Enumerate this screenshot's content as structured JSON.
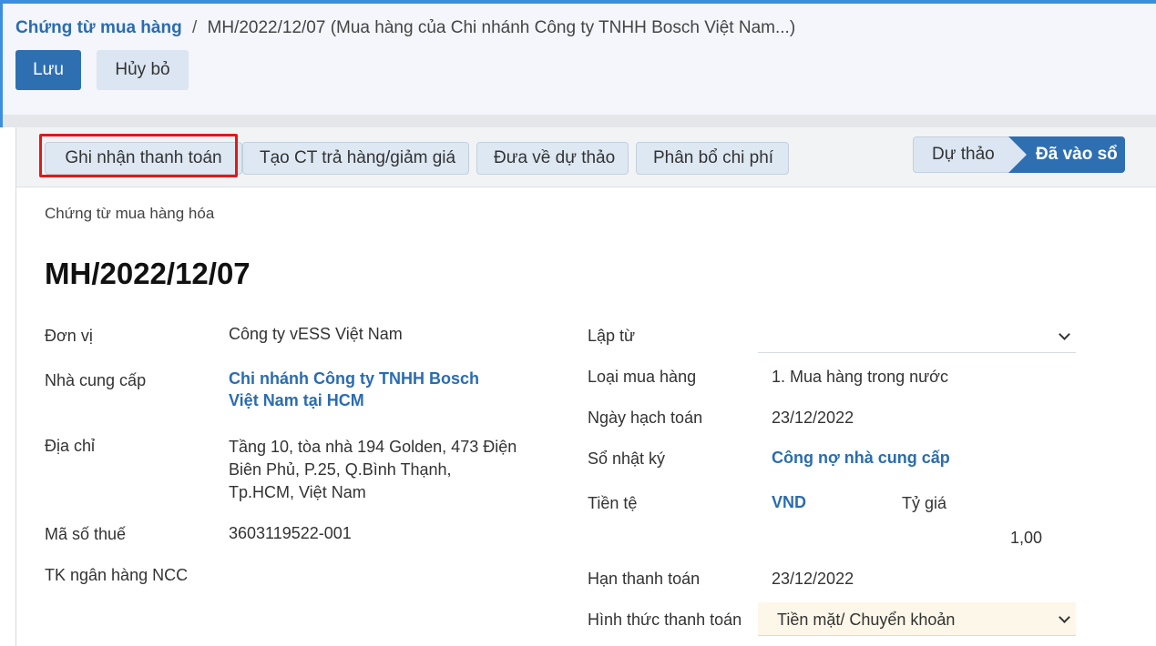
{
  "breadcrumb": {
    "parent": "Chứng từ mua hàng",
    "separator": "/",
    "current": "MH/2022/12/07 (Mua hàng của Chi nhánh Công ty TNHH Bosch Việt Nam...)"
  },
  "actions": {
    "save": "Lưu",
    "discard": "Hủy bỏ"
  },
  "statusbar": {
    "buttons": [
      "Ghi nhận thanh toán",
      "Tạo CT trả hàng/giảm giá",
      "Đưa về dự thảo",
      "Phân bổ chi phí"
    ],
    "stages": [
      "Dự thảo",
      "Đã vào sổ"
    ],
    "active_stage": "Đã vào sổ"
  },
  "form": {
    "doc_type": "Chứng từ mua hàng hóa",
    "name": "MH/2022/12/07",
    "left": {
      "company_label": "Đơn vị",
      "company": "Công ty vESS Việt Nam",
      "vendor_label": "Nhà cung cấp",
      "vendor": "Chi nhánh Công ty TNHH Bosch Việt Nam tại HCM",
      "address_label": "Địa chỉ",
      "address": "Tầng 10, tòa nhà 194 Golden, 473 Điện Biên Phủ, P.25, Q.Bình Thạnh, Tp.HCM, Việt Nam",
      "tax_label": "Mã số thuế",
      "tax": "3603119522-001",
      "bank_label": "TK ngân hàng NCC",
      "bank": ""
    },
    "right": {
      "source_label": "Lập từ",
      "source": "",
      "purchase_type_label": "Loại mua hàng",
      "purchase_type": "1. Mua hàng trong nước",
      "accounting_date_label": "Ngày hạch toán",
      "accounting_date": "23/12/2022",
      "journal_label": "Sổ nhật ký",
      "journal": "Công nợ nhà cung cấp",
      "currency_label": "Tiền tệ",
      "currency": "VND",
      "rate_label": "Tỷ giá",
      "rate": "1,00",
      "due_date_label": "Hạn thanh toán",
      "due_date": "23/12/2022",
      "payment_method_label": "Hình thức thanh toán",
      "payment_method": "Tiền mặt/ Chuyển khoản"
    }
  },
  "colors": {
    "primary": "#2e6fb2",
    "link": "#2b6cb0",
    "highlight": "#e01919"
  },
  "icons": {
    "dropdown": "chevron-down-icon"
  }
}
